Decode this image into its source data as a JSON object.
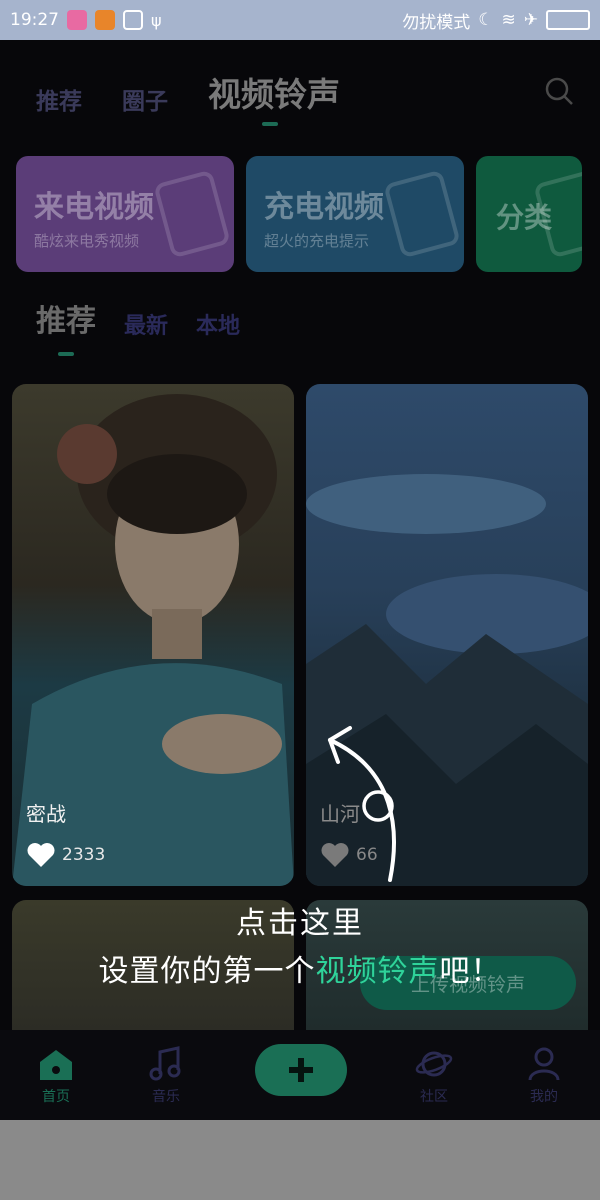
{
  "status": {
    "time": "19:27",
    "mode_text": "勿扰模式"
  },
  "top_tabs": [
    {
      "label": "推荐",
      "active": false
    },
    {
      "label": "圈子",
      "active": false
    },
    {
      "label": "视频铃声",
      "active": true
    }
  ],
  "categories": [
    {
      "title": "来电视频",
      "subtitle": "酷炫来电秀视频",
      "color": "#5b3d78"
    },
    {
      "title": "充电视频",
      "subtitle": "超火的充电提示",
      "color": "#1f4a66"
    },
    {
      "title": "分类",
      "subtitle": "",
      "color": "#0f5a3e"
    }
  ],
  "sub_tabs": [
    {
      "label": "推荐",
      "active": true
    },
    {
      "label": "最新",
      "active": false
    },
    {
      "label": "本地",
      "active": false
    }
  ],
  "videos": [
    {
      "title": "密战",
      "likes": "2333"
    },
    {
      "title": "山河",
      "likes": "66"
    }
  ],
  "guide": {
    "line1": "点击这里",
    "line2_prefix": "设置你的第一个",
    "line2_highlight": "视频铃声",
    "line2_suffix": "吧！"
  },
  "upload_button": "上传视频铃声",
  "bottom_nav": [
    {
      "label": "首页",
      "icon": "home-icon"
    },
    {
      "label": "音乐",
      "icon": "music-icon"
    },
    {
      "label": "社区",
      "icon": "planet-icon"
    },
    {
      "label": "我的",
      "icon": "person-icon"
    }
  ],
  "colors": {
    "accent": "#2fd39a",
    "highlight": "#1a6f55"
  }
}
